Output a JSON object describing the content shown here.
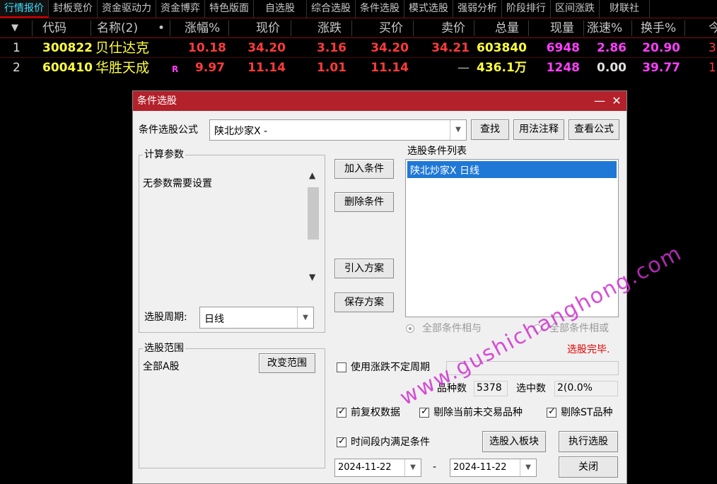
{
  "tabs": [
    "行情报价",
    "封板竞价",
    "资金驱动力",
    "资金博弈",
    "特色版面",
    "自选股",
    "综合选股",
    "条件选股",
    "模式选股",
    "强弱分析",
    "阶段排行",
    "区间涨跌",
    "财联社"
  ],
  "table": {
    "headers": [
      "▼",
      "代码",
      "名称(2)",
      "•",
      "涨幅%",
      "现价",
      "涨跌",
      "买价",
      "卖价",
      "总量",
      "现量",
      "涨速%",
      "换手%",
      "今"
    ],
    "rows": [
      {
        "idx": "1",
        "code": "300822",
        "name": "贝仕达克",
        "flag": "",
        "pct": "10.18",
        "price": "34.20",
        "chg": "3.16",
        "bid": "34.20",
        "ask": "34.21",
        "vol": "603840",
        "cur": "6948",
        "speed": "2.86",
        "turn": "20.90",
        "extra": "3"
      },
      {
        "idx": "2",
        "code": "600410",
        "name": "华胜天成",
        "flag": "R",
        "pct": "9.97",
        "price": "11.14",
        "chg": "1.01",
        "bid": "11.14",
        "ask": "—",
        "vol": "436.1万",
        "cur": "1248",
        "speed": "0.00",
        "turn": "39.77",
        "extra": "1"
      }
    ]
  },
  "dialog": {
    "title": "条件选股",
    "min_icon": "—",
    "close_icon": "✕",
    "formula_label": "条件选股公式",
    "formula_value": "陕北炒家X  -",
    "btn_find": "查找",
    "btn_usage": "用法注释",
    "btn_view": "查看公式",
    "params_group": "计算参数",
    "params_text": "无参数需要设置",
    "period_label": "选股周期:",
    "period_value": "日线",
    "btn_add": "加入条件",
    "btn_delete": "删除条件",
    "btn_import": "引入方案",
    "btn_save": "保存方案",
    "list_title": "选股条件列表",
    "list_items": [
      "陕北炒家X  日线"
    ],
    "radio_and": "全部条件相与",
    "radio_or": "全部条件相或",
    "status": "选股完毕.",
    "range_group": "选股范围",
    "range_value": "全部A股",
    "btn_change_range": "改变范围",
    "use_uncertain_period": "使用涨跌不定周期",
    "count_label": "品种数",
    "count_value": "5378",
    "selected_label": "选中数",
    "selected_value": "2(0.0%",
    "chk_fq": "前复权数据",
    "chk_remove_notrade": "剔除当前未交易品种",
    "chk_remove_st": "剔除ST品种",
    "chk_timerange": "时间段内满足条件",
    "btn_to_block": "选股入板块",
    "btn_execute": "执行选股",
    "date_from": "2024-11-22",
    "date_sep": "-",
    "date_to": "2024-11-22",
    "btn_close": "关闭"
  },
  "watermark": "www.gushichanghong.com"
}
